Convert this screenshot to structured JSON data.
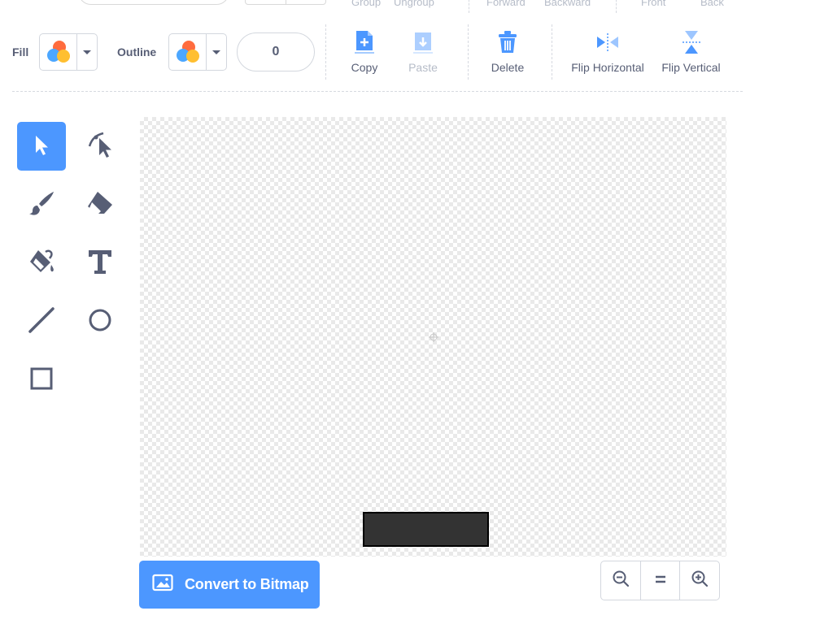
{
  "top_row": {
    "group_label": "Group",
    "ungroup_label": "Ungroup",
    "forward_label": "Forward",
    "backward_label": "Backward",
    "front_label": "Front",
    "back_label": "Back"
  },
  "fill": {
    "label": "Fill",
    "icon": "color-swatch-icon"
  },
  "outline": {
    "label": "Outline",
    "icon": "color-swatch-icon",
    "width_value": "0"
  },
  "actions": {
    "copy": "Copy",
    "paste": "Paste",
    "delete": "Delete",
    "flip_horizontal": "Flip Horizontal",
    "flip_vertical": "Flip Vertical"
  },
  "tools": [
    {
      "name": "select",
      "icon": "arrow-pointer-icon",
      "active": true
    },
    {
      "name": "reshape",
      "icon": "reshape-pointer-icon",
      "active": false
    },
    {
      "name": "brush",
      "icon": "brush-icon",
      "active": false
    },
    {
      "name": "eraser",
      "icon": "eraser-icon",
      "active": false
    },
    {
      "name": "fill",
      "icon": "paint-bucket-icon",
      "active": false
    },
    {
      "name": "text",
      "icon": "text-T-icon",
      "active": false
    },
    {
      "name": "line",
      "icon": "line-icon",
      "active": false
    },
    {
      "name": "circle",
      "icon": "circle-icon",
      "active": false
    },
    {
      "name": "rectangle",
      "icon": "square-icon",
      "active": false
    }
  ],
  "convert_button": {
    "label": "Convert to Bitmap",
    "icon": "image-icon"
  },
  "zoom": {
    "out_icon": "zoom-out-icon",
    "reset_icon": "equals-icon",
    "in_icon": "zoom-in-icon"
  },
  "colors": {
    "accent": "#4c97ff",
    "text": "#575e75",
    "disabled_text": "#b6bcc8",
    "shape_fill": "#333333",
    "shape_stroke": "#000000"
  }
}
